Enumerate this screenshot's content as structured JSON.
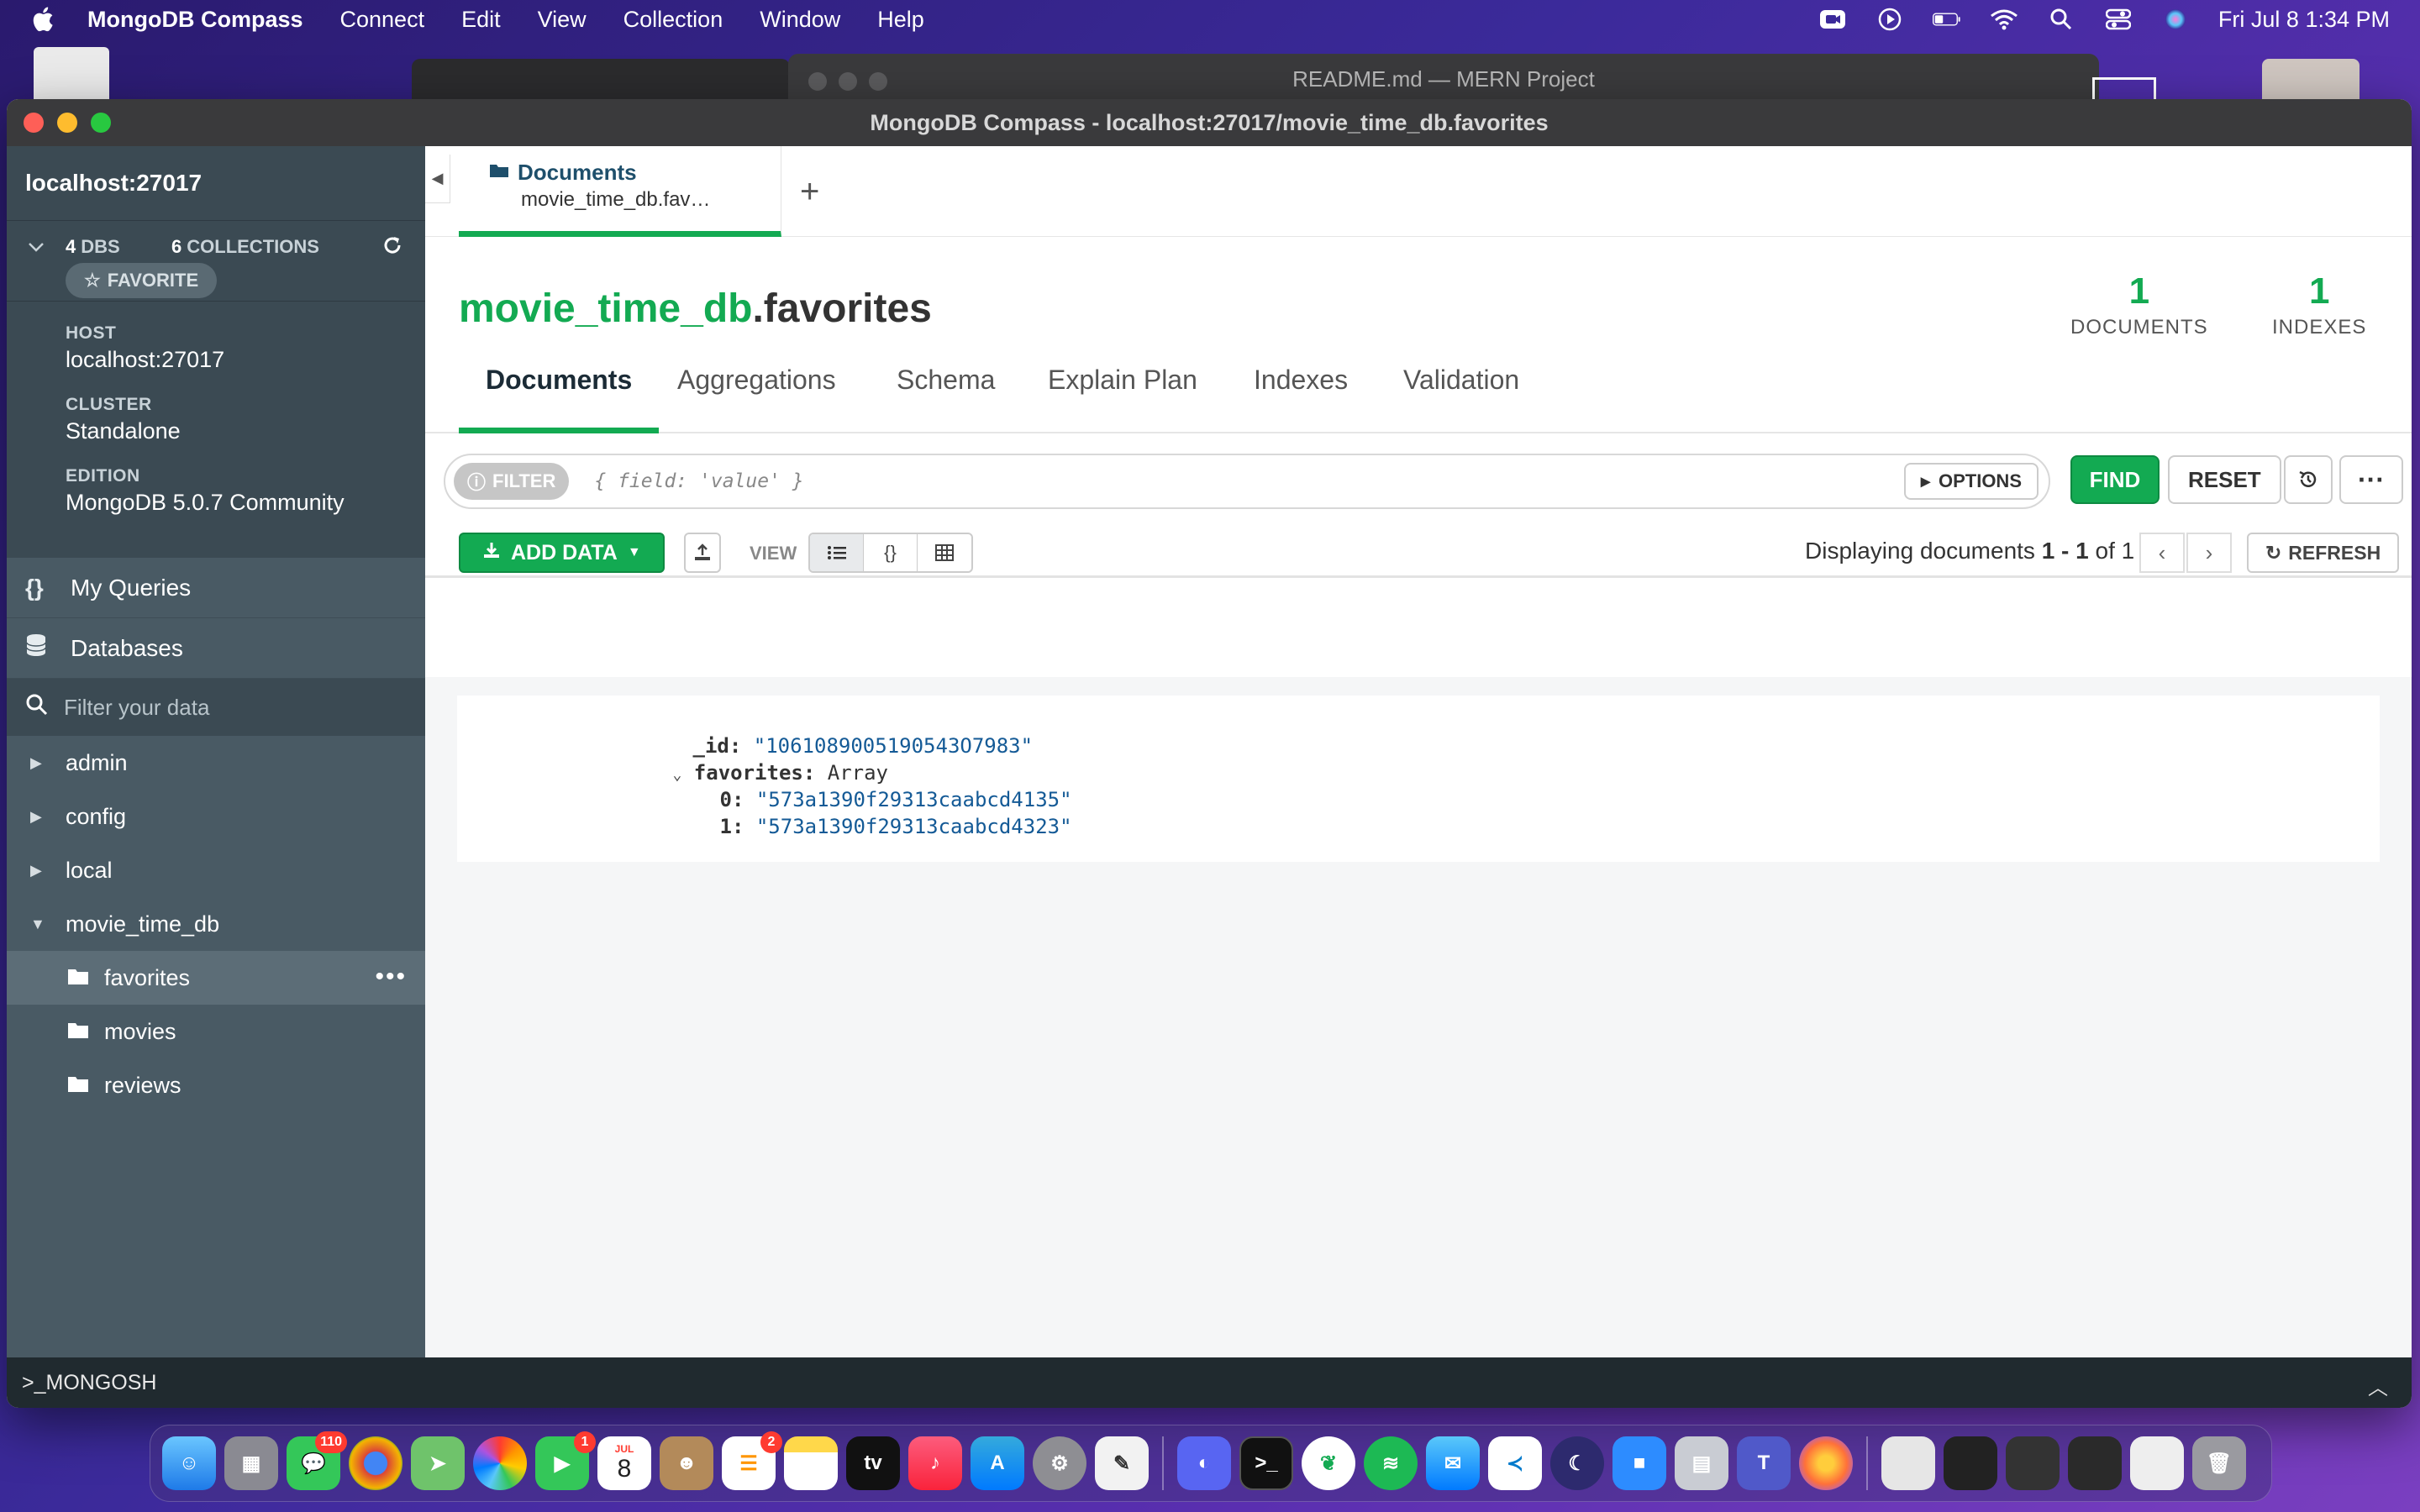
{
  "menubar": {
    "app_name": "MongoDB Compass",
    "items": [
      "Connect",
      "Edit",
      "View",
      "Collection",
      "Window",
      "Help"
    ],
    "clock": "Fri Jul 8  1:34 PM"
  },
  "background_window": {
    "title": "README.md — MERN Project"
  },
  "window": {
    "title": "MongoDB Compass - localhost:27017/movie_time_db.favorites"
  },
  "sidebar": {
    "host_title": "localhost:27017",
    "dbs_count": "4",
    "dbs_label": "DBS",
    "collections_count": "6",
    "collections_label": "COLLECTIONS",
    "favorite_label": "FAVORITE",
    "host_label": "HOST",
    "host_value": "localhost:27017",
    "cluster_label": "CLUSTER",
    "cluster_value": "Standalone",
    "edition_label": "EDITION",
    "edition_value": "MongoDB 5.0.7 Community",
    "my_queries": "My Queries",
    "databases": "Databases",
    "filter_placeholder": "Filter your data",
    "databases_list": [
      {
        "name": "admin",
        "expanded": false
      },
      {
        "name": "config",
        "expanded": false
      },
      {
        "name": "local",
        "expanded": false
      },
      {
        "name": "movie_time_db",
        "expanded": true
      }
    ],
    "collections": [
      "favorites",
      "movies",
      "reviews"
    ],
    "active_collection": "favorites"
  },
  "tab": {
    "title": "Documents",
    "subtitle": "movie_time_db.fav…"
  },
  "collection": {
    "db": "movie_time_db",
    "name": ".favorites",
    "documents_count": "1",
    "documents_label": "DOCUMENTS",
    "indexes_count": "1",
    "indexes_label": "INDEXES"
  },
  "subtabs": [
    "Documents",
    "Aggregations",
    "Schema",
    "Explain Plan",
    "Indexes",
    "Validation"
  ],
  "query": {
    "filter_label": "FILTER",
    "placeholder": "{ field: 'value' }",
    "options_label": "OPTIONS",
    "find": "FIND",
    "reset": "RESET",
    "more": "···"
  },
  "docbar": {
    "add_data": "ADD DATA",
    "view_label": "VIEW",
    "displaying_prefix": "Displaying documents",
    "range": "1 - 1",
    "of": "of",
    "total": "1",
    "refresh": "REFRESH"
  },
  "document": {
    "id_key": "_id:",
    "id_value": "\"1061089005190543O7983\"",
    "favorites_key": "favorites:",
    "favorites_type": "Array",
    "items": [
      {
        "index": "0:",
        "value": "\"573a1390f29313caabcd4135\""
      },
      {
        "index": "1:",
        "value": "\"573a1390f29313caabcd4323\""
      }
    ]
  },
  "mongosh": {
    "label": ">_MONGOSH"
  },
  "dock": {
    "badges": {
      "messages": "110",
      "facetime": "1",
      "reminders": "2"
    },
    "calendar_month": "JUL",
    "calendar_day": "8"
  },
  "colors": {
    "green": "#13aa52",
    "sidebar": "#495a64",
    "sidebar_dark": "#3b4a53",
    "string_blue": "#145a96"
  }
}
